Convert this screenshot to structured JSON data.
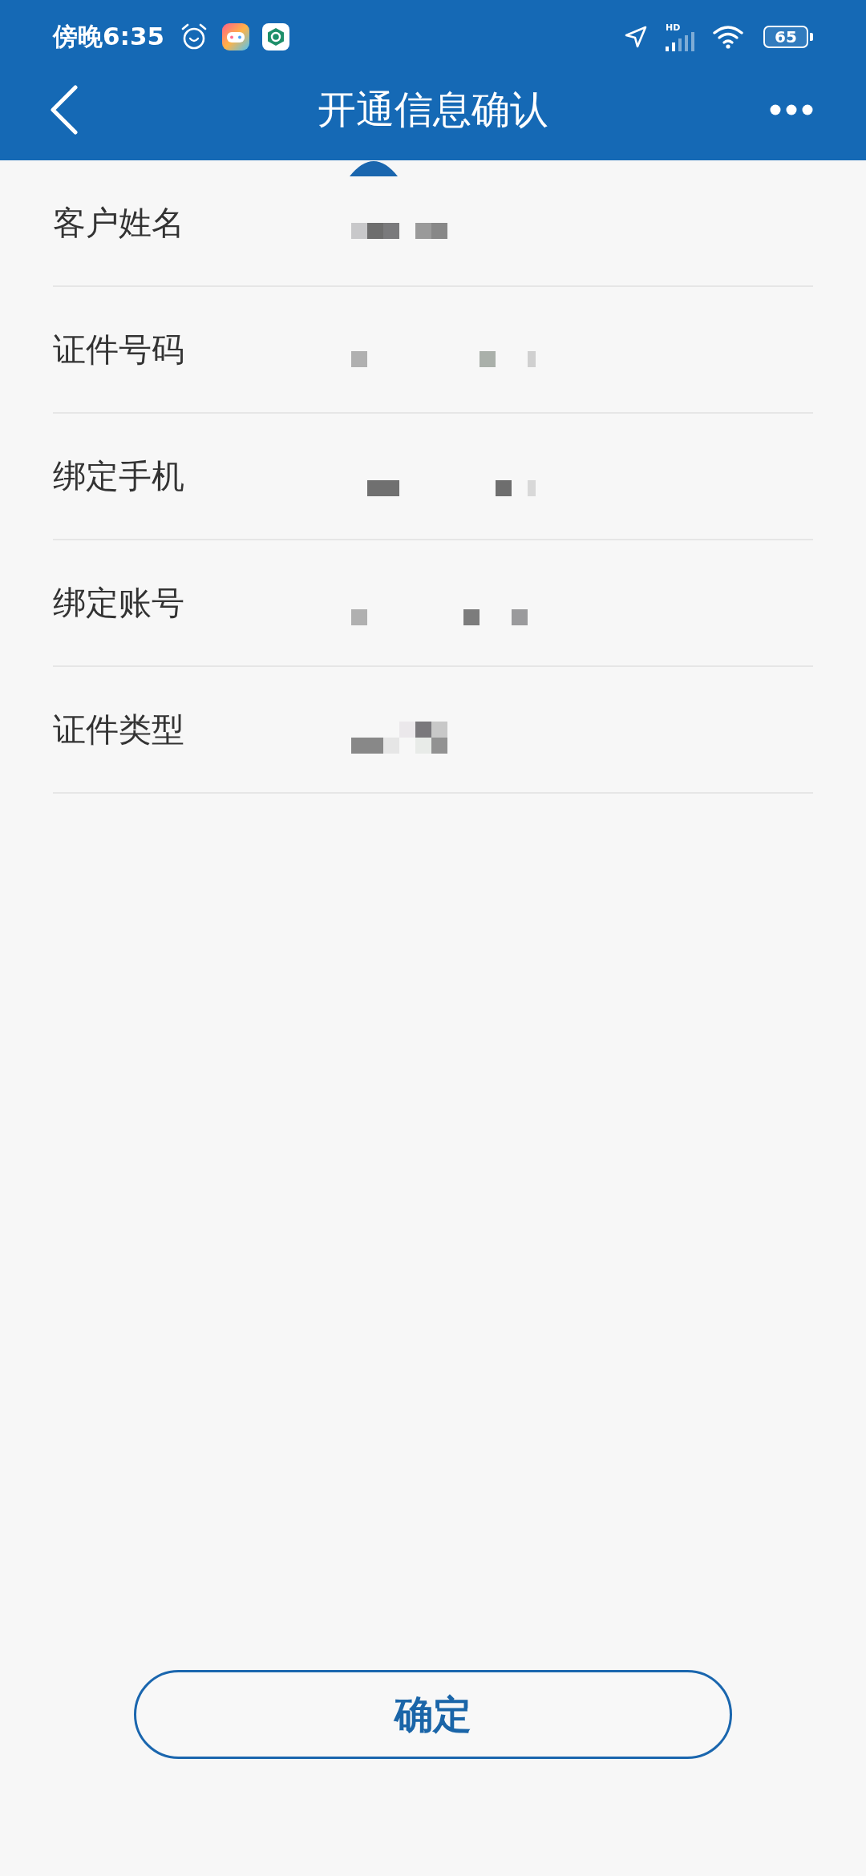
{
  "status_bar": {
    "time": "傍晚6:35",
    "network_label": "HD",
    "battery": "65"
  },
  "header": {
    "title": "开通信息确认"
  },
  "fields": [
    {
      "label": "客户姓名",
      "value_redacted": true
    },
    {
      "label": "证件号码",
      "value_redacted": true
    },
    {
      "label": "绑定手机",
      "value_redacted": true
    },
    {
      "label": "绑定账号",
      "value_redacted": true
    },
    {
      "label": "证件类型",
      "value_redacted": true
    }
  ],
  "confirm_button": {
    "label": "确定"
  }
}
